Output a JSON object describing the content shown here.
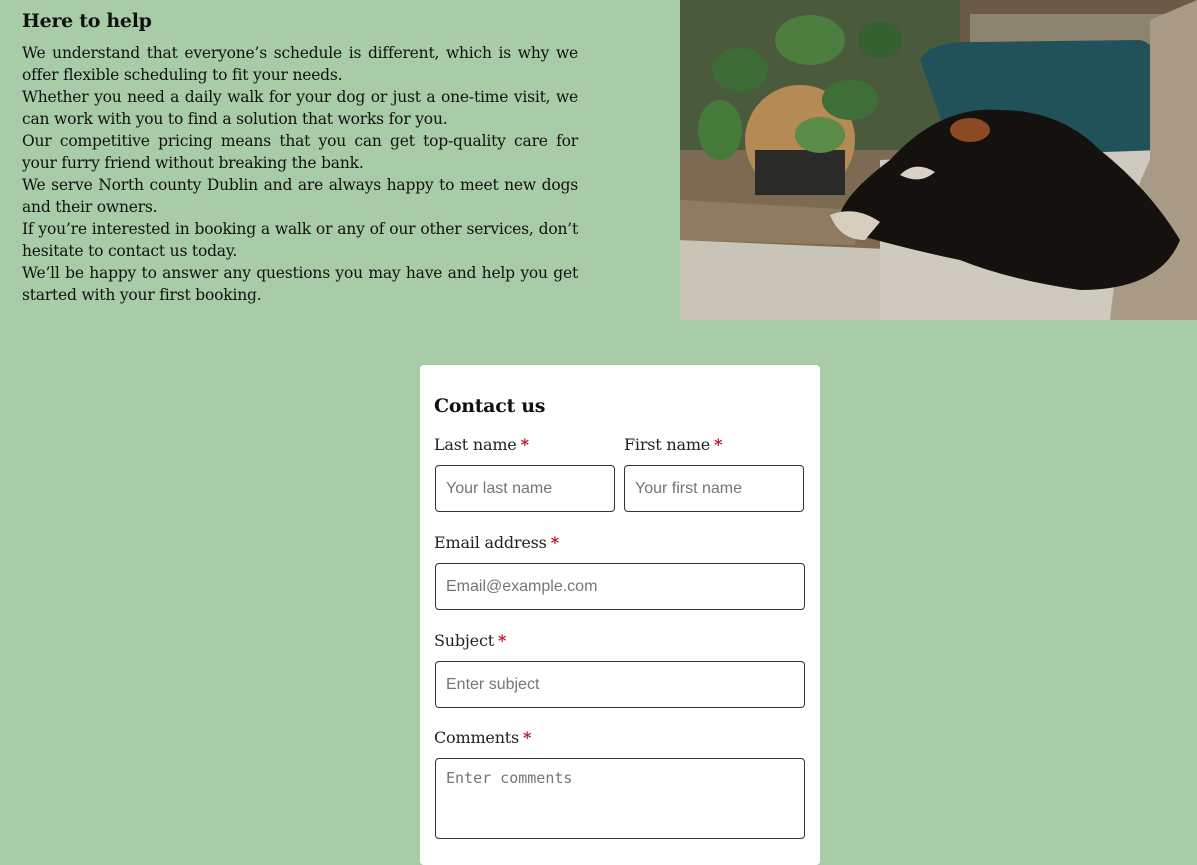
{
  "help": {
    "title": "Here to help",
    "paragraphs": [
      "We understand that everyone’s schedule is different, which is why we offer flexible scheduling to fit your needs.",
      "Whether you need a daily walk for your dog or just a one-time visit, we can work with you to find a solution that works for you.",
      "Our competitive pricing means that you can get top-quality care for your furry friend without breaking the bank.",
      "We serve North county Dublin and are always happy to meet new dogs and their owners.",
      "If you’re interested in booking a walk or any of our other services, don’t hesitate to contact us today.",
      "We’ll be happy to answer any questions you may have and help you get started with your first booking."
    ]
  },
  "form": {
    "title": "Contact us",
    "required_mark": "*",
    "last_name": {
      "label": "Last name",
      "placeholder": "Your last name"
    },
    "first_name": {
      "label": "First name",
      "placeholder": "Your first name"
    },
    "email": {
      "label": "Email address",
      "placeholder": "Email@example.com"
    },
    "subject": {
      "label": "Subject",
      "placeholder": "Enter subject"
    },
    "comments": {
      "label": "Comments",
      "placeholder": "Enter comments"
    }
  },
  "colors": {
    "background": "#a8cca7",
    "card": "#ffffff",
    "required": "#b0122c"
  }
}
